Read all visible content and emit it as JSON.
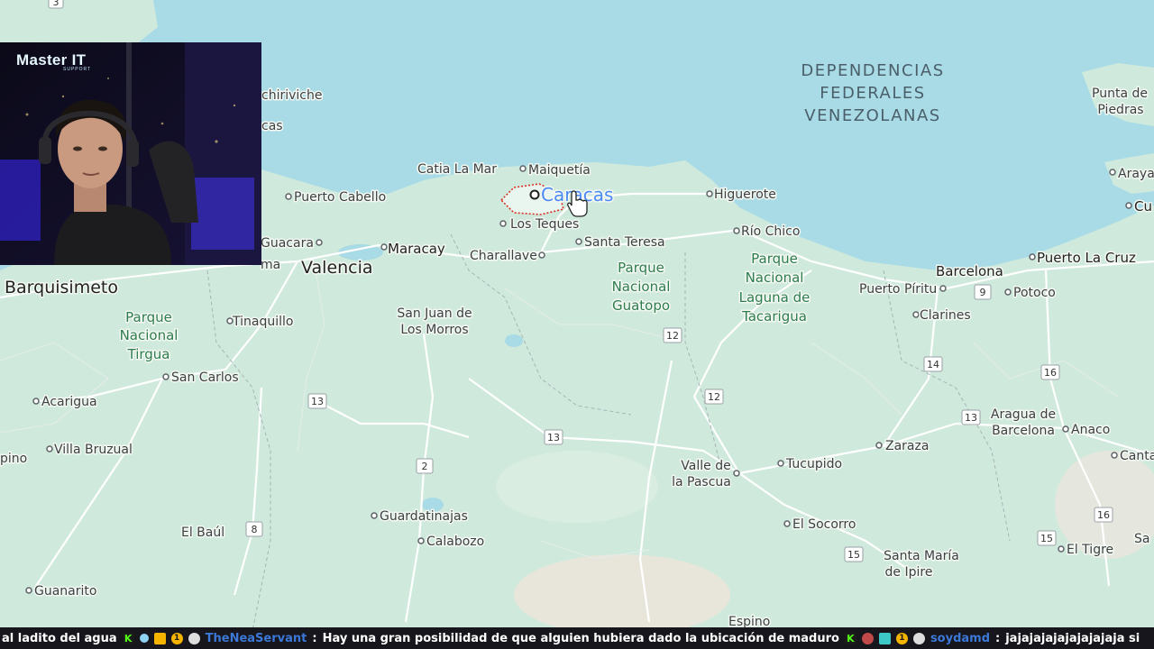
{
  "map": {
    "sea_label": [
      "DEPENDENCIAS",
      "FEDERALES",
      "VENEZOLANAS"
    ],
    "capital": "Caracas",
    "cities_major": [
      "Valencia",
      "Maracay",
      "Barquisimeto",
      "Barcelona",
      "Puerto La Cruz"
    ],
    "places": {
      "chichiriviche": "chiriviche",
      "tucacas": "cas",
      "catia": "Catia La Mar",
      "maiquetia": "Maiquetía",
      "higuerote": "Higuerote",
      "puerto_cabello": "Puerto Cabello",
      "los_teques": "Los Teques",
      "rio_chico": "Río Chico",
      "guacara": "Guacara",
      "santa_teresa": "Santa Teresa",
      "charallave": "Charallave",
      "puerto_piritu": "Puerto Píritu",
      "potoco": "Potoco",
      "tinaquillo": "Tinaquillo",
      "clarines": "Clarines",
      "san_carlos": "San Carlos",
      "acarigua": "Acarigua",
      "villa_bruzual": "Villa Bruzual",
      "aragua_barcelona_1": "Aragua de",
      "aragua_barcelona_2": "Barcelona",
      "anaco": "Anaco",
      "zaraza": "Zaraza",
      "cantaura": "Cantaura",
      "pino": "pino",
      "valle_pascua_1": "Valle de",
      "valle_pascua_2": "la Pascua",
      "tucupido": "Tucupido",
      "el_baul": "El Baúl",
      "guardatinajas": "Guardatinajas",
      "calabozo": "Calabozo",
      "el_socorro": "El Socorro",
      "el_tigre": "El Tigre",
      "santa_maria_1": "Santa María",
      "santa_maria_2": "de Ipire",
      "guanarito": "Guanarito",
      "espino": "Espino",
      "punta_piedras_1": "Punta de",
      "punta_piedras_2": "Piedras",
      "araya": "Araya",
      "cumana": "Cu",
      "san_juan_1": "San Juan de",
      "san_juan_2": "Los Morros",
      "ma": "ma",
      "sa": "Sa"
    },
    "parks": {
      "tirgua": [
        "Parque",
        "Nacional",
        "Tirgua"
      ],
      "guatopo": [
        "Parque",
        "Nacional",
        "Guatopo"
      ],
      "tacarigua": [
        "Parque",
        "Nacional",
        "Laguna de",
        "Tacarigua"
      ]
    },
    "shields": [
      "3",
      "9",
      "12",
      "12",
      "13",
      "13",
      "13",
      "14",
      "16",
      "16",
      "15",
      "15",
      "2",
      "8"
    ]
  },
  "webcam": {
    "logo_main": "Master IT",
    "logo_sub": "SUPPORT"
  },
  "chat": {
    "msg0_text": "al ladito del agua",
    "badge_k": "K",
    "msg1_user": "TheNeaServant",
    "msg1_text": "Hay una gran posibilidad de que alguien hubiera dado la ubicación de maduro",
    "msg2_user": "soydamd",
    "msg2_text": "jajajajajajajajajaja si",
    "sep": ":",
    "badge_num": "1"
  },
  "colors": {
    "sea": "#a9dbe6",
    "land": "#cfeadc",
    "road": "#ffffff",
    "capital_text": "#4a8af4",
    "username": "#3b78d8",
    "chat_bg": "#17161c"
  }
}
